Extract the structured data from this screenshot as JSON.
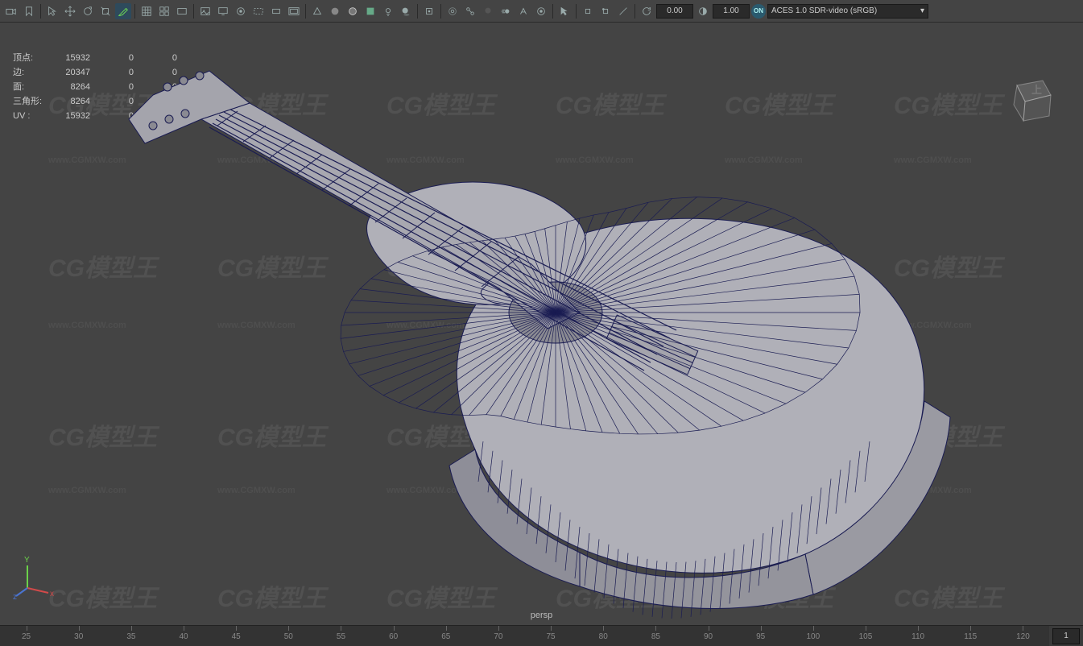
{
  "toolbar": {
    "num1": "0.00",
    "num2": "1.00",
    "on_label": "ON",
    "colorspace": "ACES 1.0 SDR-video (sRGB)"
  },
  "hud": {
    "rows": [
      {
        "label": "顶点:",
        "c1": "15932",
        "c2": "0",
        "c3": "0"
      },
      {
        "label": "边:",
        "c1": "20347",
        "c2": "0",
        "c3": "0"
      },
      {
        "label": "面:",
        "c1": "8264",
        "c2": "0",
        "c3": "0"
      },
      {
        "label": "三角形:",
        "c1": "8264",
        "c2": "0",
        "c3": "0"
      },
      {
        "label": "UV :",
        "c1": "15932",
        "c2": "0",
        "c3": "0"
      }
    ]
  },
  "watermarks": {
    "big": "CG模型王",
    "small": "www.CGMXW.com"
  },
  "camera": "persp",
  "view_cube": "上",
  "axis": {
    "x": "x",
    "y": "Y",
    "z": "z"
  },
  "timeline": {
    "ticks": [
      "25",
      "30",
      "35",
      "40",
      "45",
      "50",
      "55",
      "60",
      "65",
      "70",
      "75",
      "80",
      "85",
      "90",
      "95",
      "100",
      "105",
      "110",
      "115",
      "120"
    ],
    "current": "1"
  }
}
